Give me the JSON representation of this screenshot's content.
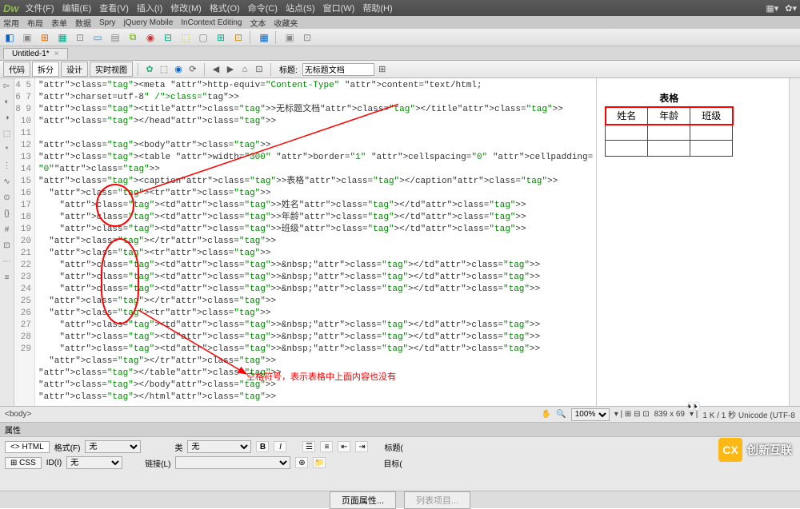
{
  "menubar": {
    "logo": "Dw",
    "items": [
      "文件(F)",
      "编辑(E)",
      "查看(V)",
      "插入(I)",
      "修改(M)",
      "格式(O)",
      "命令(C)",
      "站点(S)",
      "窗口(W)",
      "帮助(H)"
    ],
    "tail": [
      "▦▾",
      "✿▾"
    ]
  },
  "paneltabs": [
    "常用",
    "布局",
    "表单",
    "数据",
    "Spry",
    "jQuery Mobile",
    "InContext Editing",
    "文本",
    "收藏夹"
  ],
  "toolbar1": [
    "◧",
    "▣",
    "⊞",
    "▦",
    "⊡",
    "▭",
    "▤",
    "⧉",
    "◉",
    "⊟",
    "⬚",
    "▢",
    "⊞",
    "⊡",
    "▦",
    "▣",
    "⊡",
    "■",
    "▣",
    "◪"
  ],
  "doctab": {
    "name": "Untitled-1*",
    "close": "×"
  },
  "toolbar2": {
    "views": [
      "代码",
      "拆分",
      "设计",
      "实时视图"
    ],
    "title_label": "标题:",
    "title_value": "无标题文档"
  },
  "vtool": [
    "▻",
    "◐",
    "◑",
    "⬚",
    "*",
    "⋮",
    "∿",
    "⊙",
    "{}",
    "#",
    "⊡",
    "⋯",
    "≡"
  ],
  "code": {
    "start": 4,
    "lines": [
      "<meta http-equiv=\"Content-Type\" content=\"text/html;",
      "charset=utf-8\" />",
      "<title>无标题文档</title>",
      "</head>",
      "",
      "<body>",
      "<table width=\"300\" border=\"1\" cellspacing=\"0\" cellpadding=",
      "\"0\">",
      "<caption>表格</caption>",
      "  <tr>",
      "    <td>姓名</td>",
      "    <td>年龄</td>",
      "    <td>班级</td>",
      "  </tr>",
      "  <tr>",
      "    <td>&nbsp;</td>",
      "    <td>&nbsp;</td>",
      "    <td>&nbsp;</td>",
      "  </tr>",
      "  <tr>",
      "    <td>&nbsp;</td>",
      "    <td>&nbsp;</td>",
      "    <td>&nbsp;</td>",
      "  </tr>",
      "</table>",
      "</body>",
      "</html>",
      ""
    ]
  },
  "preview": {
    "caption": "表格",
    "headers": [
      "姓名",
      "年龄",
      "班级"
    ]
  },
  "annot": "空格符号，表示表格中上面内容也没有",
  "statusbar": {
    "left": "<body>",
    "zoom": "100%",
    "dims": "839 x 69",
    "info": "1 K / 1 秒 Unicode (UTF-8"
  },
  "prop": {
    "title": "属性",
    "html": "HTML",
    "css": "CSS",
    "format_l": "格式(F)",
    "format_v": "无",
    "id_l": "ID(I)",
    "id_v": "无",
    "class_l": "类",
    "class_v": "无",
    "link_l": "链接(L)",
    "t1": "标题(",
    "t2": "目标("
  },
  "bottom": {
    "b1": "页面属性...",
    "b2": "列表项目..."
  },
  "wm": {
    "logo": "CX",
    "text": "创新互联"
  }
}
